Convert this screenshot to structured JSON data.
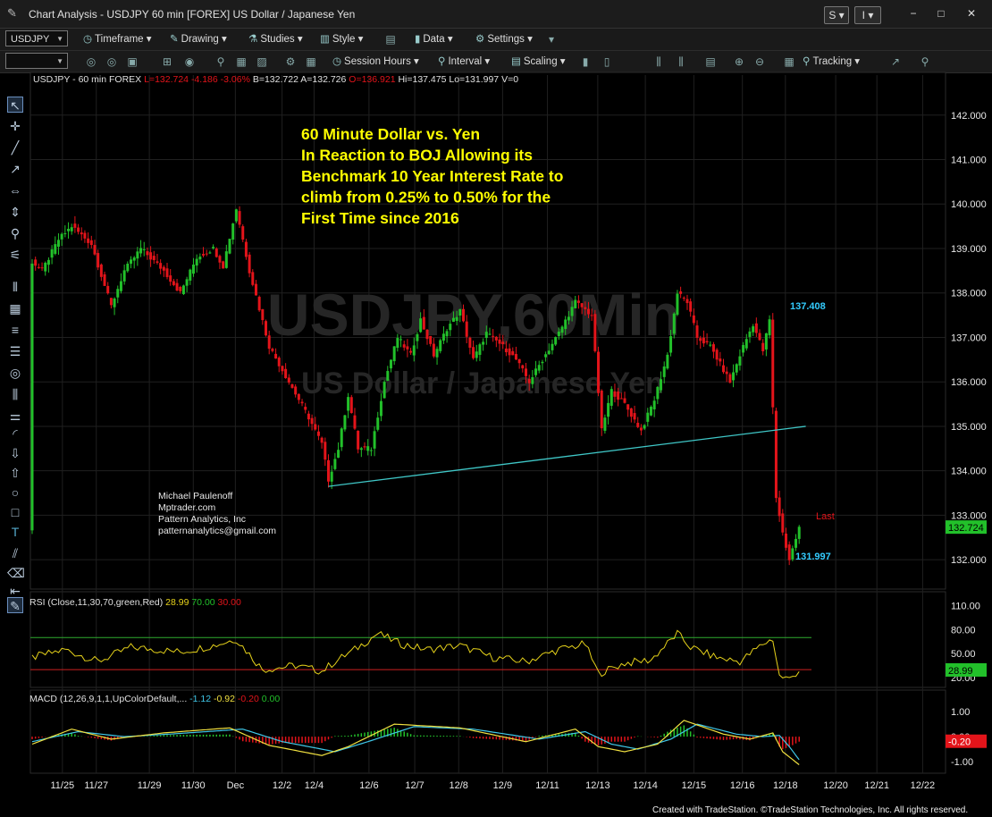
{
  "window": {
    "title": "Chart Analysis - USDJPY 60 min [FOREX] US Dollar / Japanese Yen",
    "buttons": [
      "S",
      "I"
    ]
  },
  "toolbar1": {
    "symbol": "USDJPY",
    "items": [
      "Timeframe",
      "Drawing",
      "Studies",
      "Style",
      "Data",
      "Settings"
    ]
  },
  "toolbar2": {
    "items": [
      "Session Hours",
      "Interval",
      "Scaling",
      "Tracking"
    ]
  },
  "chart_data": {
    "type": "candlestick",
    "header": {
      "symbol": "USDJPY - 60 min  FOREX",
      "L": "L=132.724",
      "chg": "-4.186",
      "pct": "-3.06%",
      "B": "B=132.722",
      "A": "A=132.726",
      "O": "O=136.921",
      "Hi": "Hi=137.475",
      "Lo": "Lo=131.997",
      "V": "V=0"
    },
    "watermark": {
      "line1": "USDJPY,60Min",
      "line2": "US Dollar / Japanese Yen"
    },
    "annotation_lines": [
      "60 Minute Dollar vs. Yen",
      "In Reaction to BOJ Allowing its",
      "Benchmark 10 Year Interest Rate to",
      "climb from 0.25% to 0.50% for the",
      "First Time since 2016"
    ],
    "credits": [
      "Michael Paulenoff",
      "Mptrader.com",
      "Pattern Analytics, Inc",
      "patternanalytics@gmail.com"
    ],
    "price_labels": {
      "high": "137.408",
      "low": "131.997",
      "last_word": "Last",
      "last_value": "132.724"
    },
    "y_ticks": [
      "142.000",
      "141.000",
      "140.000",
      "139.000",
      "138.000",
      "137.000",
      "136.000",
      "135.000",
      "134.000",
      "133.000",
      "132.000"
    ],
    "y_range": [
      131.4,
      142.9
    ],
    "x_ticks": [
      "11/25",
      "11/27",
      "11/29",
      "11/30",
      "Dec",
      "12/2",
      "12/4",
      "12/6",
      "12/7",
      "12/8",
      "12/9",
      "12/11",
      "12/13",
      "12/14",
      "12/15",
      "12/16",
      "12/18",
      "12/20",
      "12/21",
      "12/22"
    ],
    "path": [
      [
        0,
        138.7
      ],
      [
        3,
        138.5
      ],
      [
        8,
        139.2
      ],
      [
        12,
        139.5
      ],
      [
        18,
        139.1
      ],
      [
        24,
        137.7
      ],
      [
        28,
        138.5
      ],
      [
        33,
        139.0
      ],
      [
        40,
        138.5
      ],
      [
        45,
        138.0
      ],
      [
        50,
        138.8
      ],
      [
        55,
        139.0
      ],
      [
        58,
        138.6
      ],
      [
        62,
        139.9
      ],
      [
        66,
        138.5
      ],
      [
        72,
        136.8
      ],
      [
        78,
        136.0
      ],
      [
        84,
        135.2
      ],
      [
        88,
        134.6
      ],
      [
        90,
        133.8
      ],
      [
        93,
        134.5
      ],
      [
        96,
        135.7
      ],
      [
        99,
        134.5
      ],
      [
        103,
        134.5
      ],
      [
        107,
        136.0
      ],
      [
        111,
        137.0
      ],
      [
        115,
        136.6
      ],
      [
        118,
        137.4
      ],
      [
        122,
        136.6
      ],
      [
        126,
        137.2
      ],
      [
        130,
        137.6
      ],
      [
        134,
        136.5
      ],
      [
        138,
        137.1
      ],
      [
        143,
        136.8
      ],
      [
        147,
        136.5
      ],
      [
        151,
        136.0
      ],
      [
        155,
        136.5
      ],
      [
        160,
        137.1
      ],
      [
        165,
        137.8
      ],
      [
        170,
        137.5
      ],
      [
        173,
        134.9
      ],
      [
        176,
        135.8
      ],
      [
        180,
        135.5
      ],
      [
        185,
        134.9
      ],
      [
        189,
        135.6
      ],
      [
        193,
        136.6
      ],
      [
        196,
        138.0
      ],
      [
        199,
        137.8
      ],
      [
        202,
        137.0
      ],
      [
        206,
        136.8
      ],
      [
        209,
        136.4
      ],
      [
        212,
        136.0
      ],
      [
        216,
        136.8
      ],
      [
        219,
        137.3
      ],
      [
        222,
        136.7
      ],
      [
        224,
        137.4
      ],
      [
        226,
        133.4
      ],
      [
        228,
        132.6
      ],
      [
        230,
        132.0
      ],
      [
        233,
        132.72
      ]
    ],
    "n_bars": 240,
    "trendline": [
      [
        90,
        133.65
      ],
      [
        235,
        135.0
      ]
    ],
    "rsi": {
      "label": "RSI (Close,11,30,70,green,Red)",
      "values": [
        "28.99",
        "70.00",
        "30.00"
      ],
      "y_ticks": [
        "110.00",
        "80.00",
        "50.00",
        "20.00"
      ],
      "y_range": [
        10,
        125
      ],
      "last": "28.99",
      "levels": [
        70,
        30
      ],
      "path": [
        [
          0,
          45
        ],
        [
          10,
          55
        ],
        [
          20,
          40
        ],
        [
          30,
          58
        ],
        [
          45,
          52
        ],
        [
          55,
          60
        ],
        [
          62,
          68
        ],
        [
          70,
          30
        ],
        [
          80,
          35
        ],
        [
          88,
          28
        ],
        [
          92,
          40
        ],
        [
          98,
          55
        ],
        [
          105,
          75
        ],
        [
          112,
          62
        ],
        [
          120,
          55
        ],
        [
          130,
          60
        ],
        [
          140,
          45
        ],
        [
          150,
          40
        ],
        [
          160,
          55
        ],
        [
          168,
          62
        ],
        [
          172,
          25
        ],
        [
          180,
          38
        ],
        [
          188,
          42
        ],
        [
          196,
          75
        ],
        [
          200,
          58
        ],
        [
          208,
          45
        ],
        [
          215,
          40
        ],
        [
          222,
          62
        ],
        [
          225,
          68
        ],
        [
          227,
          22
        ],
        [
          230,
          18
        ],
        [
          233,
          28.99
        ]
      ]
    },
    "macd": {
      "label": "MACD (12,26,9,1,1,UpColorDefault,...",
      "values": [
        "-1.12",
        "-0.92",
        "-0.20",
        "0.00"
      ],
      "y_ticks": [
        "1.00",
        "0.00",
        "-1.00"
      ],
      "y_range": [
        -1.35,
        1.75
      ],
      "last": "-0.20",
      "macd_path": [
        [
          0,
          -0.3
        ],
        [
          12,
          0.3
        ],
        [
          24,
          -0.1
        ],
        [
          40,
          0.15
        ],
        [
          60,
          0.35
        ],
        [
          72,
          -0.35
        ],
        [
          88,
          -0.75
        ],
        [
          96,
          -0.4
        ],
        [
          110,
          0.5
        ],
        [
          130,
          0.35
        ],
        [
          150,
          -0.2
        ],
        [
          165,
          0.3
        ],
        [
          172,
          -0.4
        ],
        [
          180,
          -0.6
        ],
        [
          190,
          -0.3
        ],
        [
          198,
          0.65
        ],
        [
          210,
          0.1
        ],
        [
          218,
          -0.1
        ],
        [
          225,
          0.15
        ],
        [
          228,
          -0.6
        ],
        [
          233,
          -1.12
        ]
      ],
      "signal_path": [
        [
          0,
          -0.2
        ],
        [
          14,
          0.2
        ],
        [
          28,
          0.0
        ],
        [
          44,
          0.12
        ],
        [
          64,
          0.3
        ],
        [
          76,
          -0.2
        ],
        [
          92,
          -0.6
        ],
        [
          102,
          -0.2
        ],
        [
          116,
          0.4
        ],
        [
          134,
          0.3
        ],
        [
          154,
          -0.1
        ],
        [
          168,
          0.2
        ],
        [
          176,
          -0.3
        ],
        [
          184,
          -0.5
        ],
        [
          194,
          -0.1
        ],
        [
          202,
          0.5
        ],
        [
          214,
          0.1
        ],
        [
          222,
          0.0
        ],
        [
          227,
          0.05
        ],
        [
          230,
          -0.4
        ],
        [
          233,
          -0.92
        ]
      ]
    }
  },
  "footer": "Created with TradeStation. ©TradeStation Technologies, Inc. All rights reserved.",
  "colors": {
    "up": "#22c02a",
    "down": "#e3141a",
    "trend": "#3fc7c7",
    "rsi": "#e6d21a",
    "annot": "#ffff00",
    "cyan_label": "#33ccff",
    "grid": "#202020",
    "macd": "#f0e040",
    "signal": "#3fc7e8"
  }
}
